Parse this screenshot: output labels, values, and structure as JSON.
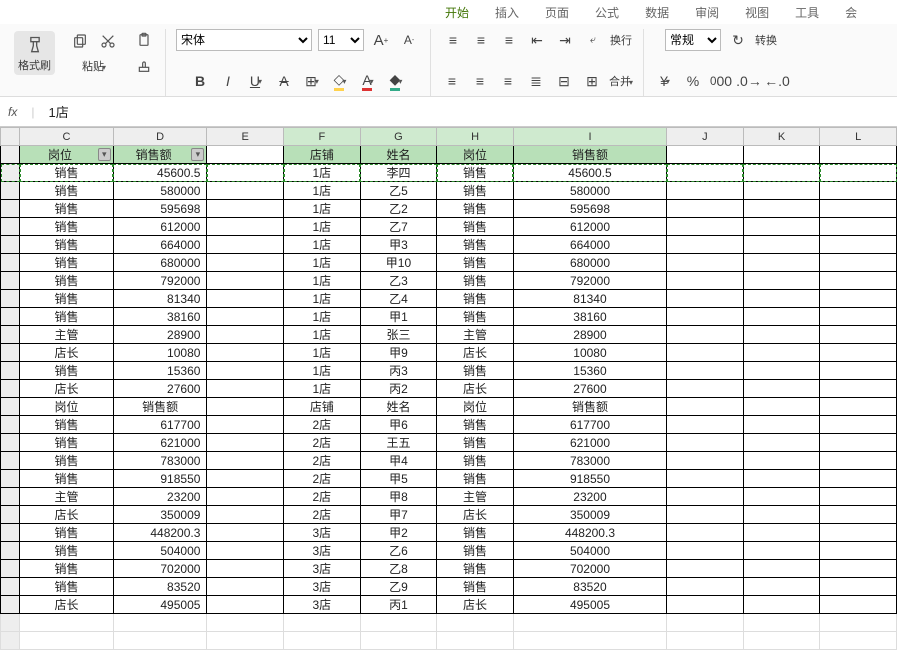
{
  "menu": {
    "items": [
      "开始",
      "插入",
      "页面",
      "公式",
      "数据",
      "审阅",
      "视图",
      "工具",
      "会"
    ],
    "active": 0
  },
  "ribbon": {
    "format_painter": "格式刷",
    "paste": "粘贴",
    "font_name": "宋体",
    "font_size": "11",
    "merge": "合并",
    "wrap": "换行",
    "number_format": "常规",
    "convert": "转换"
  },
  "formula_bar": {
    "fx": "fx",
    "value": "1店"
  },
  "col_headers": [
    "",
    "C",
    "D",
    "E",
    "F",
    "G",
    "H",
    "I",
    "J",
    "K",
    "L"
  ],
  "left_table": {
    "header": {
      "c": "岗位",
      "d": "销售额"
    },
    "rows": [
      {
        "c": "销售",
        "d": "45600.5"
      },
      {
        "c": "销售",
        "d": "580000"
      },
      {
        "c": "销售",
        "d": "595698"
      },
      {
        "c": "销售",
        "d": "612000"
      },
      {
        "c": "销售",
        "d": "664000"
      },
      {
        "c": "销售",
        "d": "680000"
      },
      {
        "c": "销售",
        "d": "792000"
      },
      {
        "c": "销售",
        "d": "81340"
      },
      {
        "c": "销售",
        "d": "38160"
      },
      {
        "c": "主管",
        "d": "28900"
      },
      {
        "c": "店长",
        "d": "10080"
      },
      {
        "c": "销售",
        "d": "15360"
      },
      {
        "c": "店长",
        "d": "27600"
      },
      {
        "c": "岗位",
        "d": "销售额"
      },
      {
        "c": "销售",
        "d": "617700"
      },
      {
        "c": "销售",
        "d": "621000"
      },
      {
        "c": "销售",
        "d": "783000"
      },
      {
        "c": "销售",
        "d": "918550"
      },
      {
        "c": "主管",
        "d": "23200"
      },
      {
        "c": "店长",
        "d": "350009"
      },
      {
        "c": "销售",
        "d": "448200.3"
      },
      {
        "c": "销售",
        "d": "504000"
      },
      {
        "c": "销售",
        "d": "702000"
      },
      {
        "c": "销售",
        "d": "83520"
      },
      {
        "c": "店长",
        "d": "495005"
      }
    ]
  },
  "right_table": {
    "header": {
      "f": "店铺",
      "g": "姓名",
      "h": "岗位",
      "i": "销售额"
    },
    "highlight_row": {
      "f": "1店",
      "g": "李四",
      "h": "销售",
      "i": "45600.5"
    },
    "rows": [
      {
        "f": "1店",
        "g": "乙5",
        "h": "销售",
        "i": "580000",
        "sz": "n"
      },
      {
        "f": "1店",
        "g": "乙2",
        "h": "销售",
        "i": "595698",
        "sz": "n"
      },
      {
        "f": "1店",
        "g": "乙7",
        "h": "销售",
        "i": "612000",
        "sz": "n"
      },
      {
        "f": "1店",
        "g": "甲3",
        "h": "销售",
        "i": "664000",
        "sz": "n"
      },
      {
        "f": "1店",
        "g": "甲10",
        "h": "销售",
        "i": "680000",
        "sz": "n"
      },
      {
        "f": "1店",
        "g": "乙3",
        "h": "销售",
        "i": "792000",
        "sz": "n"
      },
      {
        "f": "1店",
        "g": "乙4",
        "h": "销售",
        "i": "81340",
        "sz": "s"
      },
      {
        "f": "1店",
        "g": "甲1",
        "h": "销售",
        "i": "38160",
        "sz": "s"
      },
      {
        "f": "1店",
        "g": "张三",
        "h": "主管",
        "i": "28900",
        "sz": "s"
      },
      {
        "f": "1店",
        "g": "甲9",
        "h": "店长",
        "i": "10080",
        "sz": "s"
      },
      {
        "f": "1店",
        "g": "丙3",
        "h": "销售",
        "i": "15360",
        "sz": "s"
      },
      {
        "f": "1店",
        "g": "丙2",
        "h": "店长",
        "i": "27600",
        "sz": "s"
      },
      {
        "f": "店铺",
        "g": "姓名",
        "h": "岗位",
        "i": "销售额",
        "sz": "s"
      },
      {
        "f": "2店",
        "g": "甲6",
        "h": "销售",
        "i": "617700",
        "sz": "s"
      },
      {
        "f": "2店",
        "g": "王五",
        "h": "销售",
        "i": "621000",
        "sz": "s"
      },
      {
        "f": "2店",
        "g": "甲4",
        "h": "销售",
        "i": "783000",
        "sz": "s"
      },
      {
        "f": "2店",
        "g": "甲5",
        "h": "销售",
        "i": "918550",
        "sz": "s"
      },
      {
        "f": "2店",
        "g": "甲8",
        "h": "主管",
        "i": "23200",
        "sz": "s"
      },
      {
        "f": "2店",
        "g": "甲7",
        "h": "店长",
        "i": "350009",
        "sz": "n"
      },
      {
        "f": "3店",
        "g": "甲2",
        "h": "销售",
        "i": "448200.3",
        "sz": "n"
      },
      {
        "f": "3店",
        "g": "乙6",
        "h": "销售",
        "i": "504000",
        "sz": "n"
      },
      {
        "f": "3店",
        "g": "乙8",
        "h": "销售",
        "i": "702000",
        "sz": "n"
      },
      {
        "f": "3店",
        "g": "乙9",
        "h": "销售",
        "i": "83520",
        "sz": "n"
      },
      {
        "f": "3店",
        "g": "丙1",
        "h": "店长",
        "i": "495005",
        "sz": "n"
      }
    ]
  }
}
